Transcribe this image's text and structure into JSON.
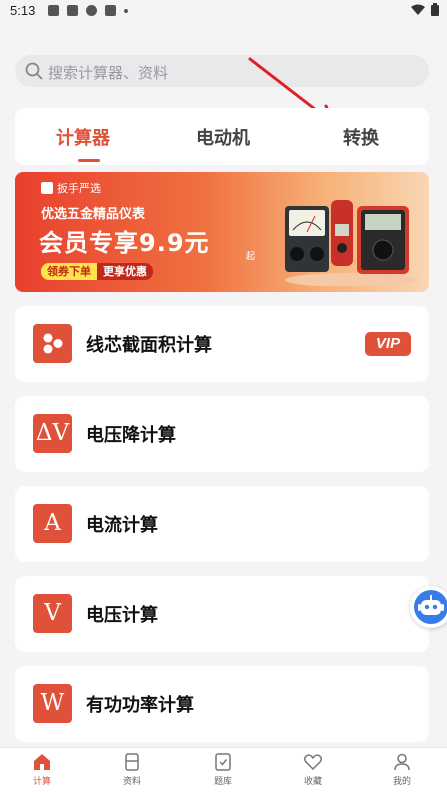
{
  "status": {
    "time": "5:13"
  },
  "search": {
    "placeholder": "搜索计算器、资料"
  },
  "tabs": [
    {
      "label": "计算器",
      "active": true
    },
    {
      "label": "电动机",
      "active": false
    },
    {
      "label": "转换",
      "active": false
    }
  ],
  "banner": {
    "brand": "扳手严选",
    "subtitle": "优选五金精品仪表",
    "headline": "会员专享9.9元",
    "headline_suffix": "起",
    "coupon_left": "领券下单",
    "coupon_right": "更享优惠"
  },
  "cards": [
    {
      "label": "线芯截面积计算",
      "icon": "cable-dots-icon",
      "icon_text": "",
      "vip": "VIP"
    },
    {
      "label": "电压降计算",
      "icon": "delta-v-icon",
      "icon_text": "ΔV"
    },
    {
      "label": "电流计算",
      "icon": "ampere-icon",
      "icon_text": "A"
    },
    {
      "label": "电压计算",
      "icon": "volt-icon",
      "icon_text": "V"
    },
    {
      "label": "有功功率计算",
      "icon": "watt-icon",
      "icon_text": "W"
    }
  ],
  "bottom_nav": [
    {
      "label": "计算",
      "icon": "home-icon",
      "active": true
    },
    {
      "label": "资料",
      "icon": "document-icon",
      "active": false
    },
    {
      "label": "题库",
      "icon": "quiz-icon",
      "active": false
    },
    {
      "label": "收藏",
      "icon": "heart-icon",
      "active": false
    },
    {
      "label": "我的",
      "icon": "user-icon",
      "active": false
    }
  ],
  "colors": {
    "accent": "#e0513a",
    "assistant": "#3a7bea"
  }
}
